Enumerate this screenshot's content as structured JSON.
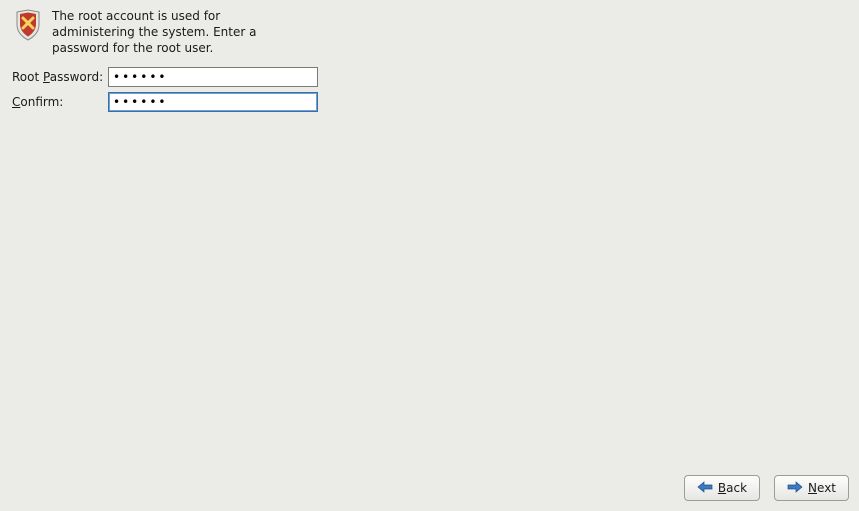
{
  "header": {
    "description": "The root account is used for administering the system.  Enter a password for the root user."
  },
  "form": {
    "root_password": {
      "label_before": "Root ",
      "label_hotkey": "P",
      "label_after": "assword:",
      "value": "••••••"
    },
    "confirm": {
      "label_hotkey": "C",
      "label_after": "onfirm:",
      "value": "••••••"
    }
  },
  "footer": {
    "back": {
      "hotkey": "B",
      "rest": "ack"
    },
    "next": {
      "hotkey": "N",
      "rest": "ext"
    }
  }
}
